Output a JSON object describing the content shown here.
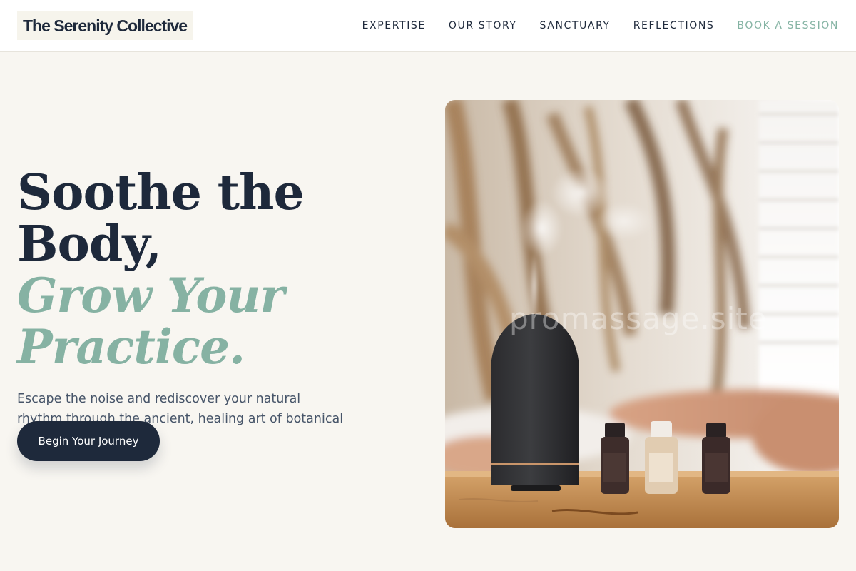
{
  "header": {
    "logo": "The Serenity Collective",
    "nav": [
      {
        "label": "EXPERTISE"
      },
      {
        "label": "OUR STORY"
      },
      {
        "label": "SANCTUARY"
      },
      {
        "label": "REFLECTIONS"
      },
      {
        "label": "BOOK A SESSION"
      }
    ]
  },
  "hero": {
    "heading_line1": "Soothe the Body,",
    "heading_line2": "Grow Your",
    "heading_line3": "Practice.",
    "description": "Escape the noise and rediscover your natural rhythm through the ancient, healing art of botanical aromatherapy.",
    "cta_label": "Begin Your Journey",
    "image_watermark": "promassage.site"
  },
  "colors": {
    "navy": "#1e293b",
    "sage": "#86b2a3",
    "background": "#f8f6f1"
  }
}
